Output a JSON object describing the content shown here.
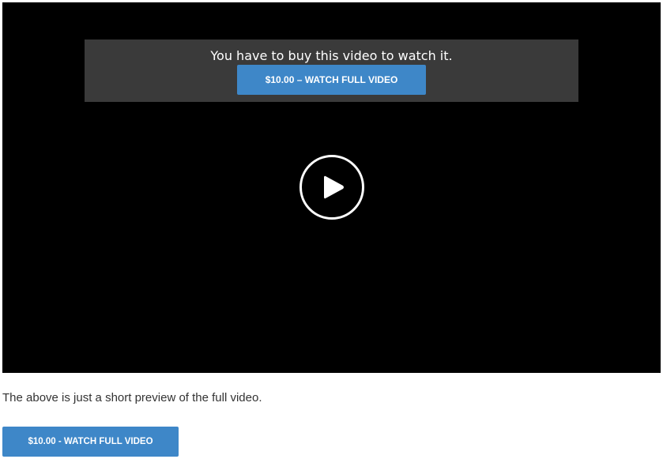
{
  "video": {
    "paywall_message": "You have to buy this video to watch it.",
    "buy_button_label": "$10.00 – WATCH FULL VIDEO",
    "play_icon": "play-icon"
  },
  "below_video": {
    "preview_note": "The above is just a short preview of the full video.",
    "buy_button_label": "$10.00 - WATCH FULL VIDEO"
  },
  "colors": {
    "player_background": "#000000",
    "overlay_background": "#3a3a3a",
    "button_accent": "#3e87c8",
    "text": "#333333"
  }
}
